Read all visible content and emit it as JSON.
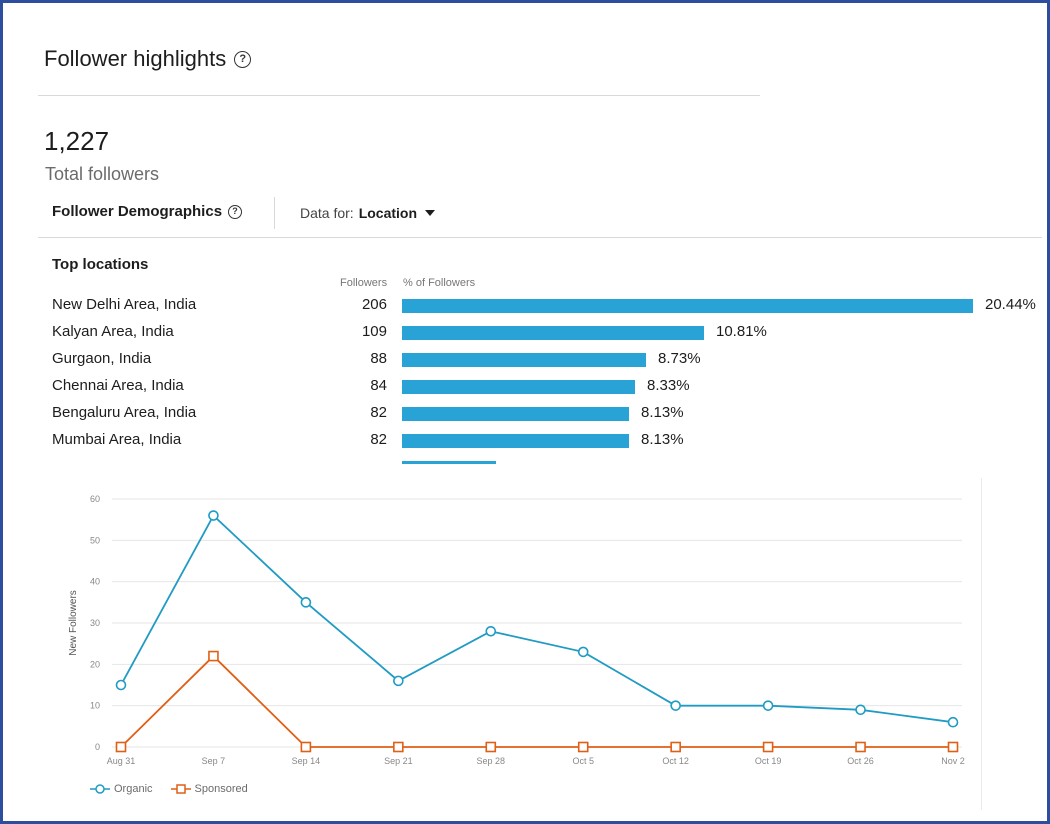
{
  "header": {
    "title": "Follower highlights",
    "help_icon": "help-circle-icon"
  },
  "total": {
    "value": "1,227",
    "label": "Total followers"
  },
  "demographics": {
    "title": "Follower Demographics",
    "data_for_label": "Data for:",
    "data_for_value": "Location"
  },
  "locations": {
    "title": "Top locations",
    "col_followers": "Followers",
    "col_pct": "% of Followers",
    "max_pct": 20.44,
    "rows": [
      {
        "name": "New Delhi Area, India",
        "count": "206",
        "pct_label": "20.44%",
        "pct": 20.44
      },
      {
        "name": "Kalyan Area, India",
        "count": "109",
        "pct_label": "10.81%",
        "pct": 10.81
      },
      {
        "name": "Gurgaon, India",
        "count": "88",
        "pct_label": "8.73%",
        "pct": 8.73
      },
      {
        "name": "Chennai Area, India",
        "count": "84",
        "pct_label": "8.33%",
        "pct": 8.33
      },
      {
        "name": "Bengaluru Area, India",
        "count": "82",
        "pct_label": "8.13%",
        "pct": 8.13
      },
      {
        "name": "Mumbai Area, India",
        "count": "82",
        "pct_label": "8.13%",
        "pct": 8.13
      }
    ]
  },
  "colors": {
    "accent": "#29a3d6",
    "organic": "#1f9bc4",
    "sponsored": "#e05f15",
    "grid": "#e6e6e6"
  },
  "chart_data": {
    "type": "line",
    "x": [
      "Aug 31",
      "Sep 7",
      "Sep 14",
      "Sep 21",
      "Sep 28",
      "Oct 5",
      "Oct 12",
      "Oct 19",
      "Oct 26",
      "Nov 2"
    ],
    "series": [
      {
        "name": "Organic",
        "values": [
          15,
          56,
          35,
          16,
          28,
          23,
          10,
          10,
          9,
          6
        ]
      },
      {
        "name": "Sponsored",
        "values": [
          0,
          22,
          0,
          0,
          0,
          0,
          0,
          0,
          0,
          0
        ]
      }
    ],
    "ylabel": "New Followers",
    "ylim": [
      0,
      60
    ],
    "yticks": [
      "0",
      "10",
      "20",
      "30",
      "40",
      "50",
      "60"
    ],
    "grid": true,
    "legend": "bottom-left"
  }
}
